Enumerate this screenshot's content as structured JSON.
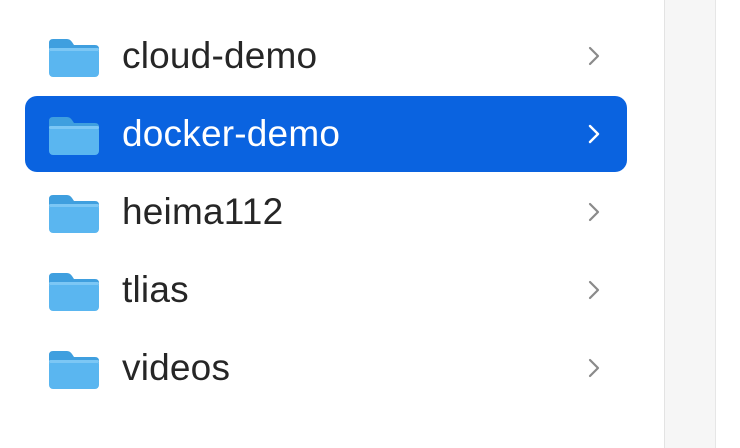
{
  "finder": {
    "items": [
      {
        "label": "cloud-demo",
        "selected": false,
        "icon": "folder-icon",
        "disclosure": "chevron-right-icon"
      },
      {
        "label": "docker-demo",
        "selected": true,
        "icon": "folder-icon",
        "disclosure": "chevron-right-icon"
      },
      {
        "label": "heima112",
        "selected": false,
        "icon": "folder-icon",
        "disclosure": "chevron-right-icon"
      },
      {
        "label": "tlias",
        "selected": false,
        "icon": "folder-icon",
        "disclosure": "chevron-right-icon"
      },
      {
        "label": "videos",
        "selected": false,
        "icon": "folder-icon",
        "disclosure": "chevron-right-icon"
      }
    ]
  },
  "colors": {
    "selection": "#0a63e0",
    "folder_body": "#5ab6f0",
    "folder_tab": "#3f9fdf",
    "text": "#262626",
    "chevron": "#8a8a8a",
    "chevron_selected": "#ffffff"
  }
}
